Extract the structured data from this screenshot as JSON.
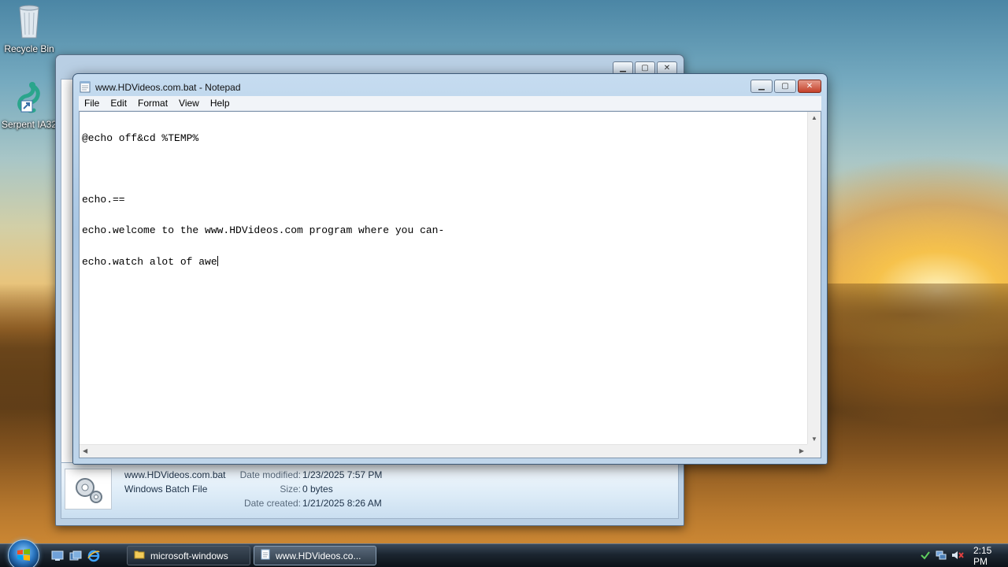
{
  "desktop": {
    "icons": [
      {
        "label": "Recycle Bin"
      },
      {
        "label": "Serpent IA32"
      }
    ]
  },
  "explorer": {
    "details": {
      "file_name": "www.HDVideos.com.bat",
      "file_type": "Windows Batch File",
      "date_modified_label": "Date modified:",
      "date_modified_value": "1/23/2025 7:57 PM",
      "size_label": "Size:",
      "size_value": "0 bytes",
      "date_created_label": "Date created:",
      "date_created_value": "1/21/2025 8:26 AM"
    }
  },
  "notepad": {
    "title": "www.HDVideos.com.bat - Notepad",
    "menu": [
      "File",
      "Edit",
      "Format",
      "View",
      "Help"
    ],
    "lines": [
      "@echo off&cd %TEMP%",
      "",
      "echo.==",
      "echo.welcome to the www.HDVideos.com program where you can-",
      "echo.watch alot of awe"
    ]
  },
  "taskbar": {
    "buttons": [
      {
        "label": "microsoft-windows"
      },
      {
        "label": "www.HDVideos.co..."
      }
    ],
    "clock": "2:15 PM"
  },
  "colors": {
    "accent": "#2b77c2",
    "close_button": "#c4412a"
  }
}
